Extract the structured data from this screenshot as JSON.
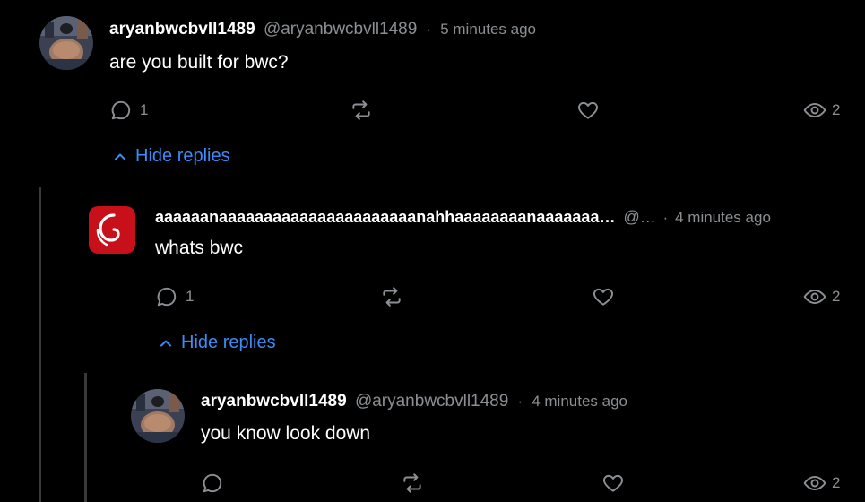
{
  "comments": [
    {
      "username": "aryanbwcbvll1489",
      "handle": "@aryanbwcbvll1489",
      "separator": "·",
      "time": "5 minutes ago",
      "text": "are you built for bwc?",
      "reply_count": "1",
      "view_count": "2",
      "hide_replies_label": "Hide replies",
      "avatar_icon": "profile-photo"
    },
    {
      "username": "aaaaaanaaaaaaaaaaaaaaaaaaaaaanahhaaaaaaaanaaaaaaa…",
      "handle": "@…",
      "separator": "·",
      "time": "4 minutes ago",
      "text": "whats bwc",
      "reply_count": "1",
      "view_count": "2",
      "hide_replies_label": "Hide replies",
      "avatar_icon": "debian-swirl-logo"
    },
    {
      "username": "aryanbwcbvll1489",
      "handle": "@aryanbwcbvll1489",
      "separator": "·",
      "time": "4 minutes ago",
      "text": "you know look down",
      "reply_count": "",
      "view_count": "2",
      "avatar_icon": "profile-photo"
    }
  ],
  "colors": {
    "background": "#000000",
    "link": "#3b8cf6",
    "muted": "#8b8f93",
    "thread_line": "#3a3a3a",
    "debian_red": "#c8101a"
  }
}
